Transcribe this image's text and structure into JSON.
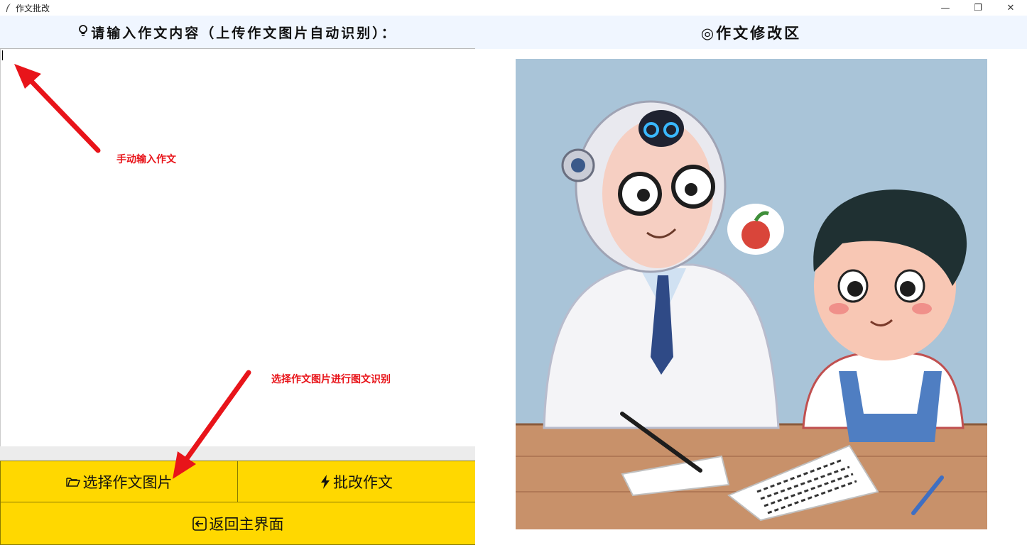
{
  "window": {
    "title": "作文批改",
    "controls": {
      "minimize": "—",
      "restore": "❐",
      "close": "✕"
    }
  },
  "left_panel": {
    "header": "请输入作文内容（上传作文图片自动识别）：",
    "editor_value": "",
    "buttons": {
      "select_image": "选择作文图片",
      "grade": "批改作文",
      "back": "返回主界面"
    }
  },
  "annotations": {
    "manual_input": "手动输入作文",
    "select_image_hint": "选择作文图片进行图文识别"
  },
  "right_panel": {
    "header": "◎作文修改区"
  },
  "icons": {
    "header_left": "lightbulb-icon",
    "select_image": "folder-open-icon",
    "grade": "lightning-icon",
    "back": "arrow-back-icon"
  },
  "colors": {
    "button_bg": "#ffd800",
    "header_bg": "#f0f6ff",
    "annotation": "#e8141a"
  }
}
